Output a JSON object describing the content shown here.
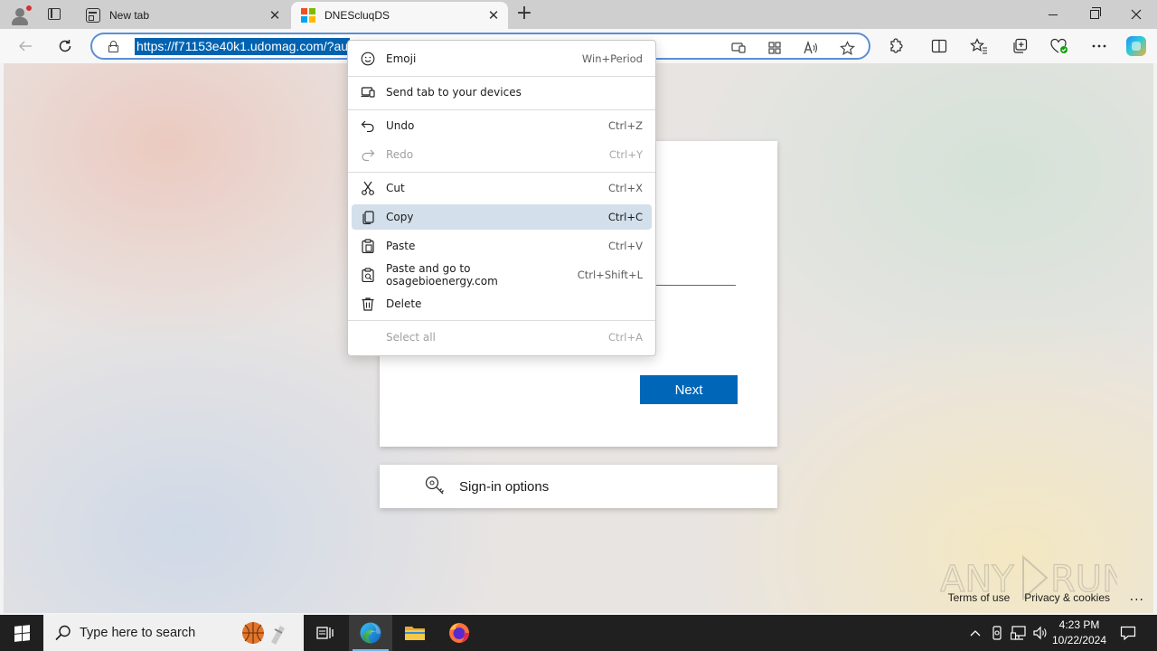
{
  "browser": {
    "tabs": [
      {
        "title": "New tab",
        "active": false
      },
      {
        "title": "DNEScluqDS",
        "active": true
      }
    ],
    "new_tab_symbol": "+",
    "close_symbol": "✕",
    "address": {
      "selected_text": "https://f71153e40k1.udomag.com/?au"
    }
  },
  "page": {
    "next_button": "Next",
    "signin_options": "Sign-in options",
    "footer": {
      "terms": "Terms of use",
      "privacy": "Privacy & cookies",
      "more": "..."
    },
    "watermark": "ANY RUN"
  },
  "context_menu": {
    "items": [
      {
        "label": "Emoji",
        "shortcut": "Win+Period",
        "icon": "emoji-icon",
        "enabled": true,
        "highlighted": false
      },
      {
        "label": "Send tab to your devices",
        "shortcut": "",
        "icon": "devices-icon",
        "enabled": true,
        "highlighted": false
      },
      {
        "label": "Undo",
        "shortcut": "Ctrl+Z",
        "icon": "undo-icon",
        "enabled": true,
        "highlighted": false
      },
      {
        "label": "Redo",
        "shortcut": "Ctrl+Y",
        "icon": "redo-icon",
        "enabled": false,
        "highlighted": false
      },
      {
        "label": "Cut",
        "shortcut": "Ctrl+X",
        "icon": "cut-icon",
        "enabled": true,
        "highlighted": false
      },
      {
        "label": "Copy",
        "shortcut": "Ctrl+C",
        "icon": "copy-icon",
        "enabled": true,
        "highlighted": true
      },
      {
        "label": "Paste",
        "shortcut": "Ctrl+V",
        "icon": "paste-icon",
        "enabled": true,
        "highlighted": false
      },
      {
        "label": "Paste and go to osagebioenergy.com",
        "shortcut": "Ctrl+Shift+L",
        "icon": "paste-go-icon",
        "enabled": true,
        "highlighted": false
      },
      {
        "label": "Delete",
        "shortcut": "",
        "icon": "delete-icon",
        "enabled": true,
        "highlighted": false
      },
      {
        "label": "Select all",
        "shortcut": "Ctrl+A",
        "icon": "",
        "enabled": false,
        "highlighted": false
      }
    ]
  },
  "taskbar": {
    "search_placeholder": "Type here to search",
    "time": "4:23 PM",
    "date": "10/22/2024",
    "pinned": [
      "task-view-icon",
      "edge-icon",
      "file-explorer-icon",
      "firefox-icon"
    ]
  },
  "colors": {
    "accent": "#0067b8",
    "selection": "#0063b1",
    "menu_highlight": "#d3dfeb",
    "taskbar": "#202020"
  }
}
